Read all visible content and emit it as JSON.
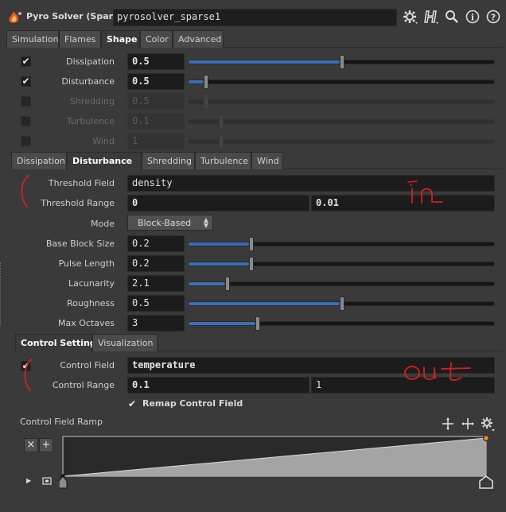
{
  "header": {
    "node_type": "Pyro Solver (Sparse)",
    "node_name": "pyrosolver_sparse1",
    "icons": [
      "gear-icon",
      "houdini-h-icon",
      "search-icon",
      "info-icon",
      "help-icon"
    ]
  },
  "main_tabs": [
    {
      "label": "Simulation",
      "active": false
    },
    {
      "label": "Flames",
      "active": false
    },
    {
      "label": "Shape",
      "active": true
    },
    {
      "label": "Color",
      "active": false
    },
    {
      "label": "Advanced",
      "active": false
    }
  ],
  "shape_params": [
    {
      "label": "Dissipation",
      "checked": true,
      "value": "0.5",
      "enabled": true,
      "level": 0.5
    },
    {
      "label": "Disturbance",
      "checked": true,
      "value": "0.5",
      "enabled": true,
      "level": 0.05
    },
    {
      "label": "Shredding",
      "checked": false,
      "value": "0.5",
      "enabled": false,
      "level": 0.05
    },
    {
      "label": "Turbulence",
      "checked": false,
      "value": "0.1",
      "enabled": false,
      "level": 0.1
    },
    {
      "label": "Wind",
      "checked": false,
      "value": "1",
      "enabled": false,
      "level": 0.1
    }
  ],
  "sub_tabs": [
    {
      "label": "Dissipation",
      "active": false
    },
    {
      "label": "Disturbance",
      "active": true
    },
    {
      "label": "Shredding",
      "active": false
    },
    {
      "label": "Turbulence",
      "active": false
    },
    {
      "label": "Wind",
      "active": false
    }
  ],
  "disturbance": {
    "threshold_field_label": "Threshold Field",
    "threshold_field_value": "density",
    "threshold_range_label": "Threshold Range",
    "threshold_range_min": "0",
    "threshold_range_max": "0.01",
    "mode_label": "Mode",
    "mode_value": "Block-Based",
    "sliders": [
      {
        "label": "Base Block Size",
        "value": "0.2",
        "level": 0.2
      },
      {
        "label": "Pulse Length",
        "value": "0.2",
        "level": 0.2
      },
      {
        "label": "Lacunarity",
        "value": "2.1",
        "level": 0.12
      },
      {
        "label": "Roughness",
        "value": "0.5",
        "level": 0.5
      },
      {
        "label": "Max Octaves",
        "value": "3",
        "level": 0.22
      }
    ]
  },
  "control_tabs": [
    {
      "label": "Control Settings",
      "active": true
    },
    {
      "label": "Visualization",
      "active": false
    }
  ],
  "control": {
    "control_field_label": "Control Field",
    "control_field_checked": true,
    "control_field_value": "temperature",
    "control_range_label": "Control Range",
    "control_range_min": "0.1",
    "control_range_max": "1",
    "remap_label": "Remap Control Field",
    "remap_checked": true,
    "ramp_label": "Control Field Ramp",
    "ramp_remove": "×",
    "ramp_add": "+"
  },
  "annotations": {
    "in_text": "in",
    "out_text": "out",
    "color": "#d42020"
  },
  "colors": {
    "accent": "#3a6fb5",
    "background": "#3a3a3a",
    "field": "#1c1c1c"
  }
}
